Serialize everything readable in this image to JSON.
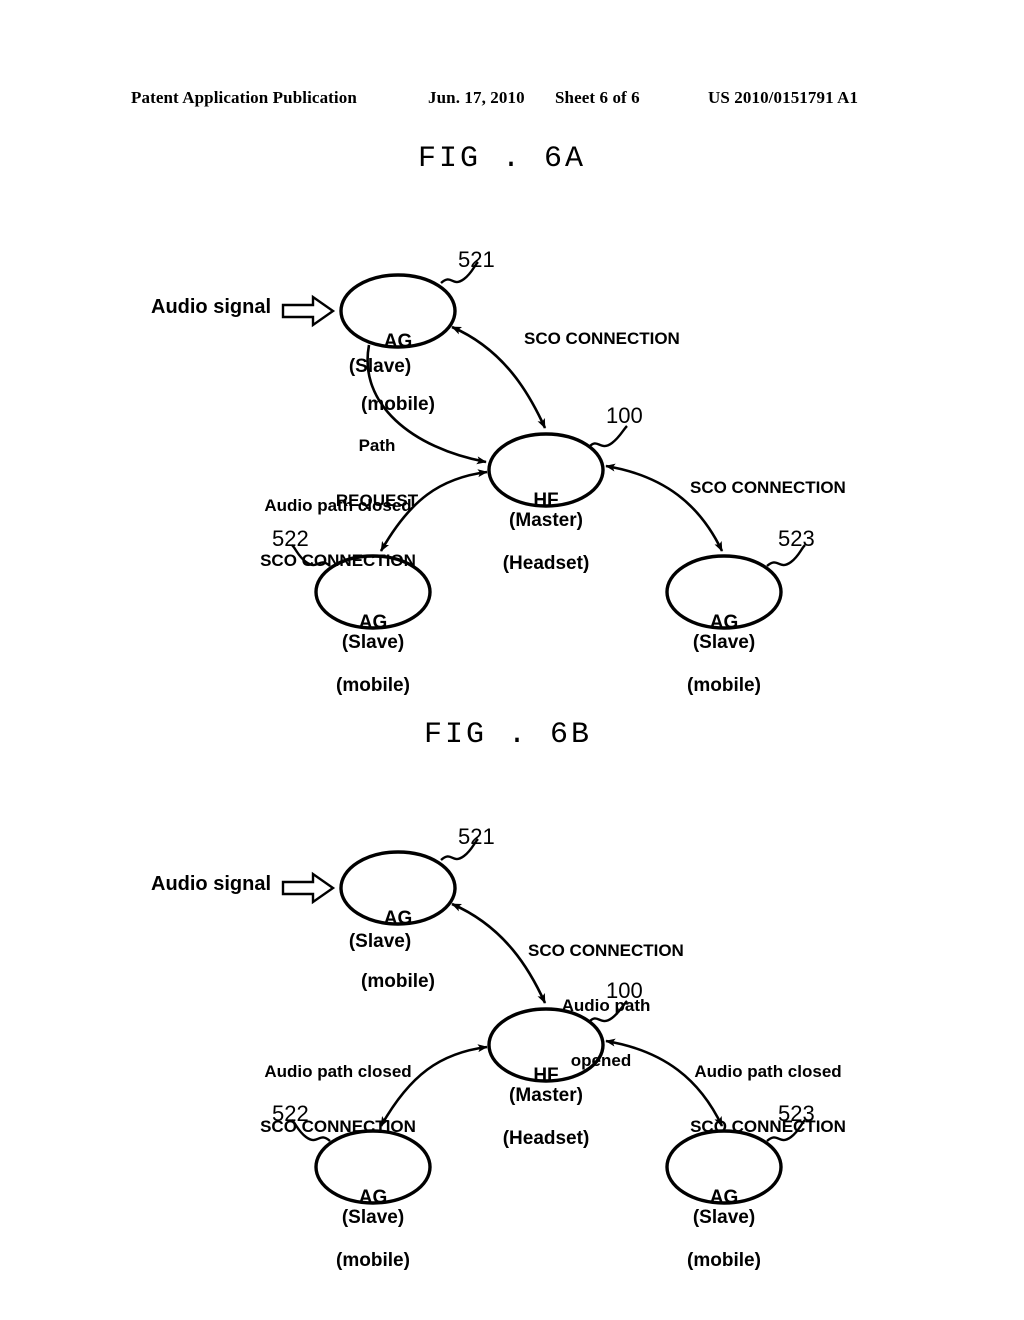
{
  "header": {
    "publication": "Patent Application Publication",
    "date": "Jun. 17, 2010",
    "sheet": "Sheet 6 of 6",
    "patent_number": "US 2010/0151791 A1"
  },
  "figures": [
    {
      "id": "fig6a",
      "title": "FIG . 6A",
      "input_label": "Audio signal",
      "nodes": {
        "ag_top": {
          "ref": "521",
          "line1": "AG",
          "line2": "(mobile)",
          "role": "(Slave)"
        },
        "hf_center": {
          "ref": "100",
          "line1": "HF",
          "line2": "(Headset)",
          "role": "(Master)"
        },
        "ag_left": {
          "ref": "522",
          "line1": "AG",
          "line2": "(mobile)",
          "role": "(Slave)"
        },
        "ag_right": {
          "ref": "523",
          "line1": "AG",
          "line2": "(mobile)",
          "role": "(Slave)"
        }
      },
      "edges": {
        "top_right": "SCO CONNECTION",
        "top_left_1": "Path",
        "top_left_2": "REQUEST",
        "left_1": "Audio path closed",
        "left_2": "SCO CONNECTION",
        "right_1": "SCO CONNECTION"
      }
    },
    {
      "id": "fig6b",
      "title": "FIG . 6B",
      "input_label": "Audio signal",
      "nodes": {
        "ag_top": {
          "ref": "521",
          "line1": "AG",
          "line2": "(mobile)",
          "role": "(Slave)"
        },
        "hf_center": {
          "ref": "100",
          "line1": "HF",
          "line2": "(Headset)",
          "role": "(Master)"
        },
        "ag_left": {
          "ref": "522",
          "line1": "AG",
          "line2": "(mobile)",
          "role": "(Slave)"
        },
        "ag_right": {
          "ref": "523",
          "line1": "AG",
          "line2": "(mobile)",
          "role": "(Slave)"
        }
      },
      "edges": {
        "top_1": "SCO CONNECTION",
        "top_2": "Audio path",
        "top_3": "opened",
        "left_1": "Audio path closed",
        "left_2": "SCO CONNECTION",
        "right_1": "Audio path closed",
        "right_2": "SCO CONNECTION"
      }
    }
  ],
  "colors": {
    "ink": "#000000",
    "paper": "#ffffff"
  }
}
